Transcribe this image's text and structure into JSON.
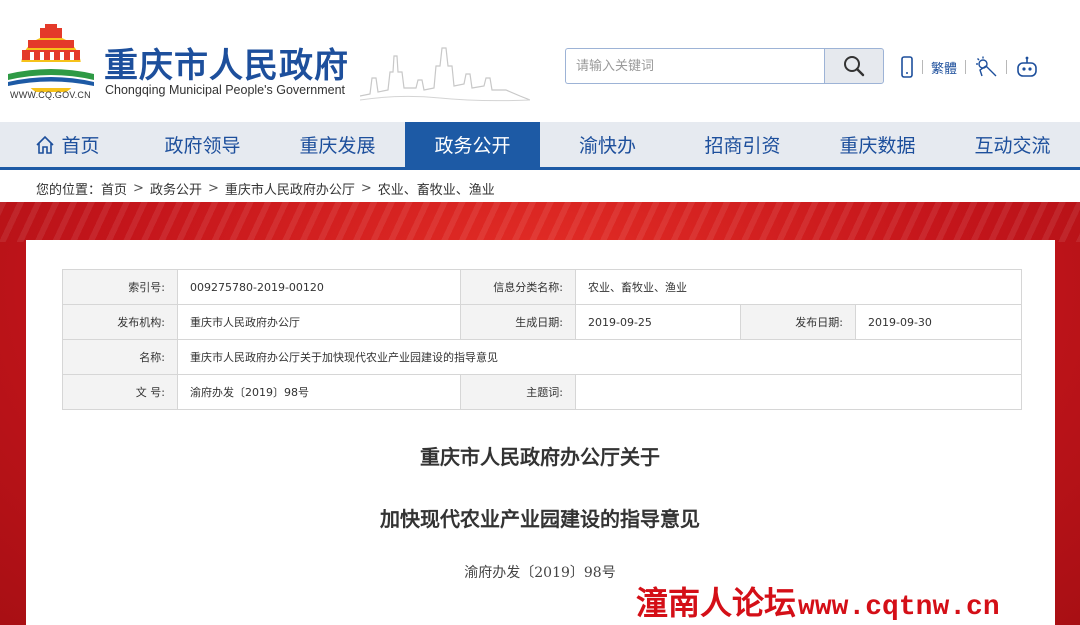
{
  "header": {
    "logo_url": "WWW.CQ.GOV.CN",
    "title": "重庆市人民政府",
    "subtitle": "Chongqing Municipal People's Government"
  },
  "search": {
    "placeholder": "请输入关键词",
    "icon": "search-icon"
  },
  "tools": {
    "mobile_icon": "mobile-phone-icon",
    "traditional": "繁體",
    "weather_icon": "weather-icon",
    "robot_icon": "robot-icon"
  },
  "nav": {
    "items": [
      {
        "label": "首页",
        "icon": "home-icon"
      },
      {
        "label": "政府领导"
      },
      {
        "label": "重庆发展"
      },
      {
        "label": "政务公开",
        "active": true
      },
      {
        "label": "渝快办"
      },
      {
        "label": "招商引资"
      },
      {
        "label": "重庆数据"
      },
      {
        "label": "互动交流"
      }
    ]
  },
  "breadcrumb": {
    "prefix": "您的位置：",
    "items": [
      "首页",
      "政务公开",
      "重庆市人民政府办公厅",
      "农业、畜牧业、渔业"
    ]
  },
  "info": {
    "index_label": "索引号:",
    "index_value": "009275780-2019-00120",
    "category_label": "信息分类名称:",
    "category_value": "农业、畜牧业、渔业",
    "publisher_label": "发布机构:",
    "publisher_value": "重庆市人民政府办公厅",
    "created_label": "生成日期:",
    "created_value": "2019-09-25",
    "published_label": "发布日期:",
    "published_value": "2019-09-30",
    "name_label": "名称:",
    "name_value": "重庆市人民政府办公厅关于加快现代农业产业园建设的指导意见",
    "docno_label": "文 号:",
    "docno_value": "渝府办发〔2019〕98号",
    "subject_label": "主题词:",
    "subject_value": ""
  },
  "document": {
    "title_line1": "重庆市人民政府办公厅关于",
    "title_line2": "加快现代农业产业园建设的指导意见",
    "number": "渝府办发〔2019〕98号"
  },
  "watermark": {
    "cn": "潼南人论坛",
    "url": "www.cqtnw.cn"
  },
  "colors": {
    "brand_blue": "#1d5aa5",
    "title_blue": "#1d4f9c",
    "banner_red": "#c4151b",
    "watermark_red": "#d40f17"
  }
}
